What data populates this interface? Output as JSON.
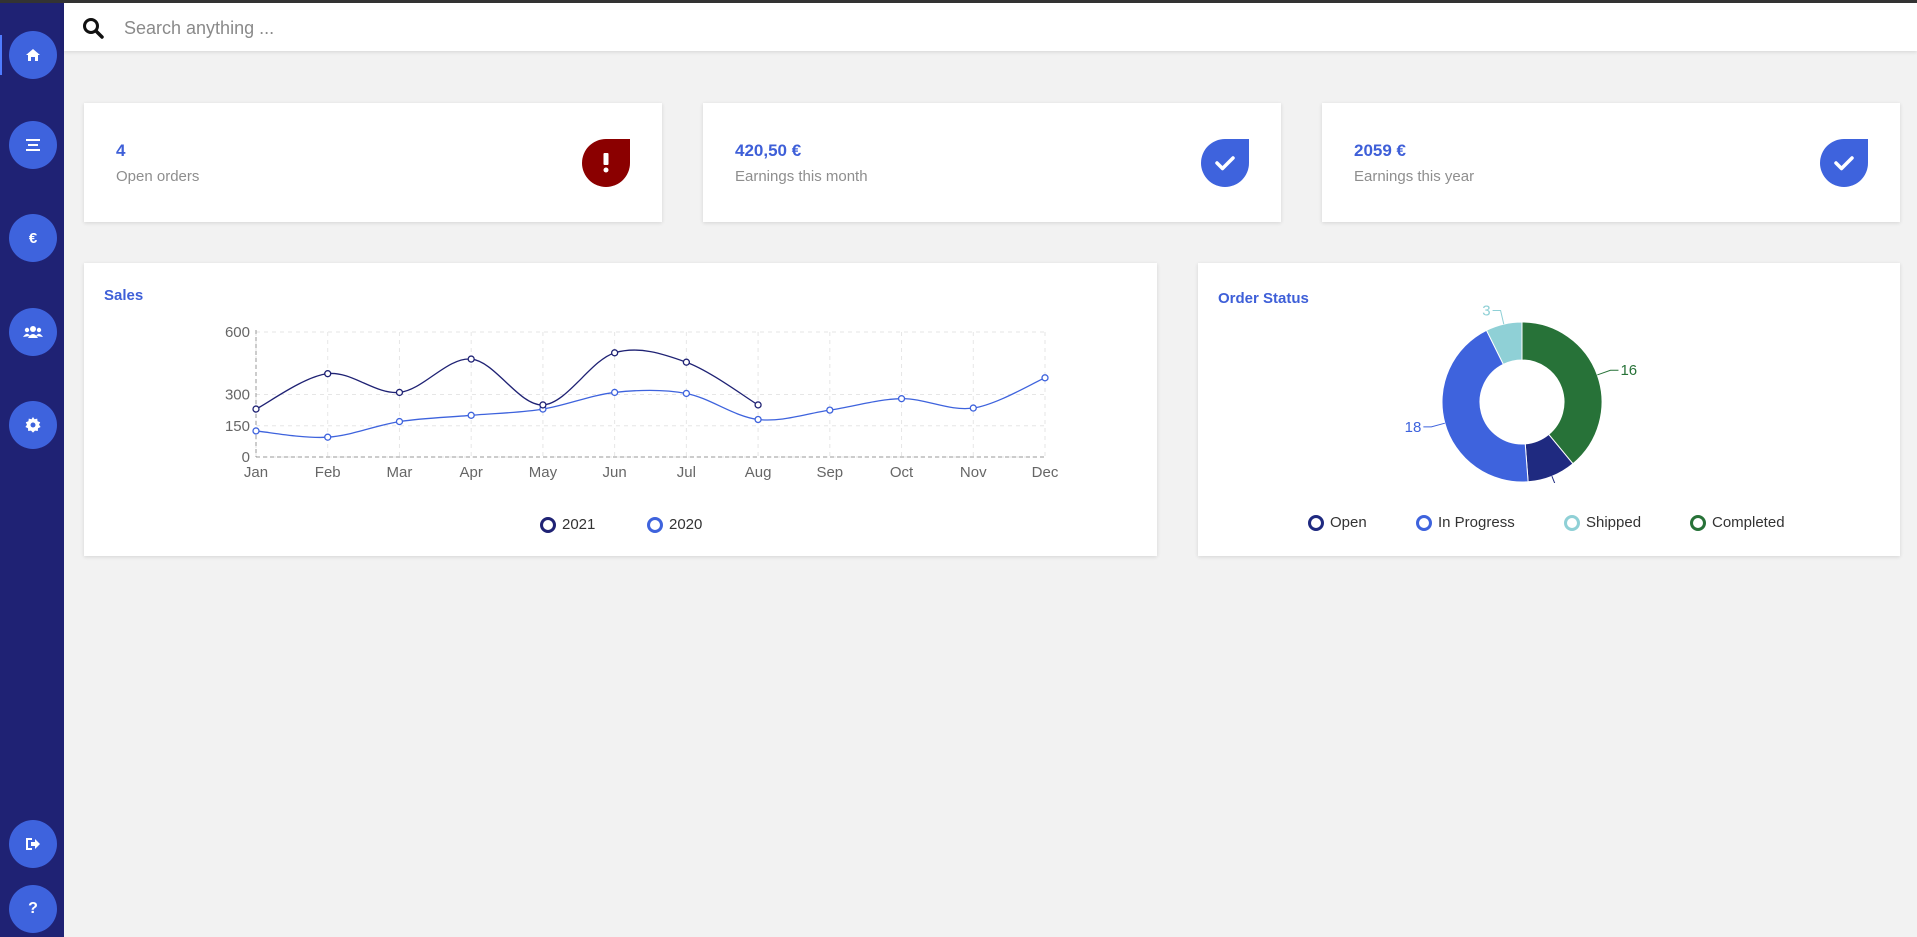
{
  "search": {
    "placeholder": "Search anything ..."
  },
  "sidebar": {
    "items": [
      {
        "name": "home",
        "icon": "home-icon",
        "active": true
      },
      {
        "name": "menu",
        "icon": "list-icon"
      },
      {
        "name": "earnings",
        "icon": "euro-icon"
      },
      {
        "name": "users",
        "icon": "users-icon"
      },
      {
        "name": "settings",
        "icon": "gear-icon"
      }
    ],
    "bottom_items": [
      {
        "name": "logout",
        "icon": "logout-icon"
      },
      {
        "name": "help",
        "icon": "help-icon"
      }
    ]
  },
  "stats": [
    {
      "value": "4",
      "label": "Open orders",
      "badge": "alert-icon",
      "badge_color": "#8b0000"
    },
    {
      "value": "420,50 €",
      "label": "Earnings this month",
      "badge": "check-icon",
      "badge_color": "#3e63dd"
    },
    {
      "value": "2059 €",
      "label": "Earnings this year",
      "badge": "check-icon",
      "badge_color": "#3e63dd"
    }
  ],
  "sales": {
    "title": "Sales",
    "chart_data": {
      "type": "line",
      "categories": [
        "Jan",
        "Feb",
        "Mar",
        "Apr",
        "May",
        "Jun",
        "Jul",
        "Aug",
        "Sep",
        "Oct",
        "Nov",
        "Dec"
      ],
      "ylim": [
        0,
        600
      ],
      "yticks": [
        0,
        150,
        300,
        600
      ],
      "grid": true,
      "legend_position": "bottom",
      "series": [
        {
          "name": "2021",
          "color": "#1f2274",
          "values": [
            230,
            400,
            310,
            470,
            250,
            500,
            455,
            250
          ]
        },
        {
          "name": "2020",
          "color": "#3e63dd",
          "values": [
            125,
            95,
            170,
            200,
            230,
            310,
            305,
            180,
            225,
            280,
            235,
            380
          ]
        }
      ]
    }
  },
  "order_status": {
    "title": "Order Status",
    "chart_data": {
      "type": "pie",
      "donut": true,
      "legend_position": "bottom",
      "slices": [
        {
          "name": "Open",
          "value": 4,
          "color": "#1f2a80"
        },
        {
          "name": "In Progress",
          "value": 18,
          "color": "#3e63dd"
        },
        {
          "name": "Shipped",
          "value": 3,
          "color": "#8fd0d6"
        },
        {
          "name": "Completed",
          "value": 16,
          "color": "#277238"
        }
      ]
    }
  }
}
